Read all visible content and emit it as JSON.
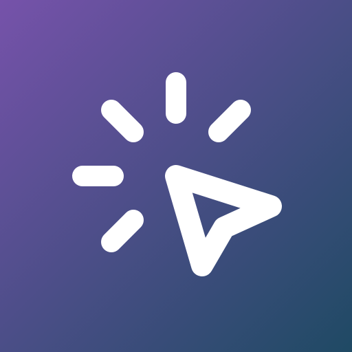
{
  "icon": {
    "semantic": "click-cursor-icon",
    "gradient": {
      "start": "#7652aa",
      "end": "#1f4a64"
    },
    "glyph_color": "#ffffff"
  }
}
